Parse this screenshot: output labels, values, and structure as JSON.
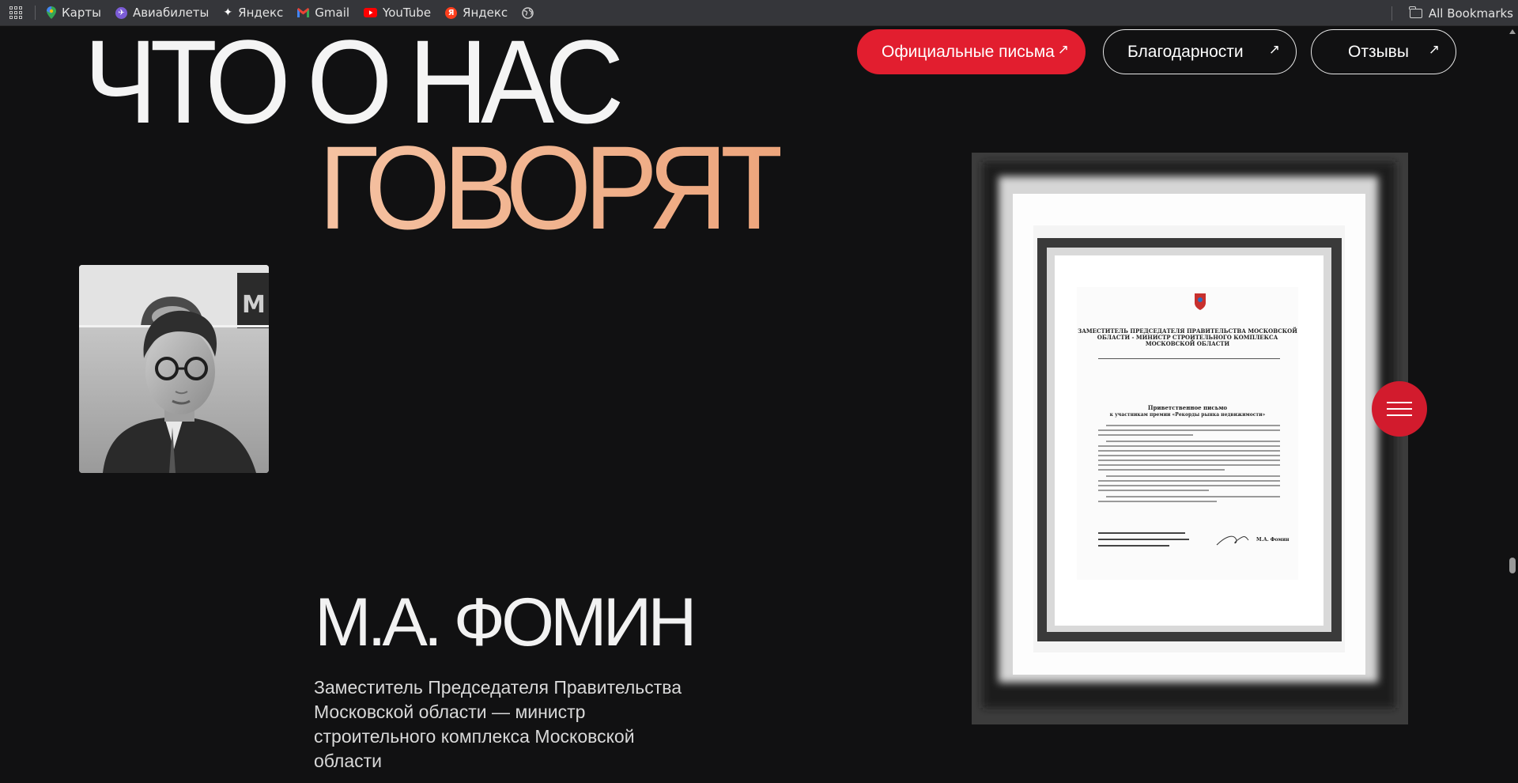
{
  "bookmarks": {
    "items": [
      {
        "label": "Карты",
        "icon": "maps-pin-icon",
        "color": "#34a853"
      },
      {
        "label": "Авиабилеты",
        "icon": "flights-globe-icon",
        "color": "#7b5cd6"
      },
      {
        "label": "Яндекс",
        "icon": "yandex-star-icon",
        "color": "#2b2b2b"
      },
      {
        "label": "Gmail",
        "icon": "gmail-icon",
        "color": "#ea4335"
      },
      {
        "label": "YouTube",
        "icon": "youtube-icon",
        "color": "#ff0000"
      },
      {
        "label": "Яндекс",
        "icon": "yandex-icon",
        "color": "#fc3f1d"
      }
    ],
    "all_bookmarks": "All Bookmarks"
  },
  "heading": {
    "line1": "ЧТО О НАС",
    "line2": "ГОВОРЯТ"
  },
  "filters": {
    "official": "Официальные письма",
    "thanks": "Благодарности",
    "reviews": "Отзывы",
    "arrow": "↗",
    "active_color": "#e21e2f"
  },
  "person": {
    "name": "М.А. ФОМИН",
    "role": "Заместитель Председателя Правительства Московской области — министр строительного комплекса Московской области"
  },
  "letter": {
    "header": "ЗАМЕСТИТЕЛЬ ПРЕДСЕДАТЕЛЯ ПРАВИТЕЛЬСТВА МОСКОВСКОЙ ОБЛАСТИ - МИНИСТР СТРОИТЕЛЬНОГО КОМПЛЕКСА МОСКОВСКОЙ ОБЛАСТИ",
    "subject": "Приветственное письмо",
    "subject2": "к участникам премии «Рекорды рынка недвижимости»",
    "signature": "М.А. Фомин"
  },
  "menu": {
    "icon": "hamburger-menu-icon"
  }
}
